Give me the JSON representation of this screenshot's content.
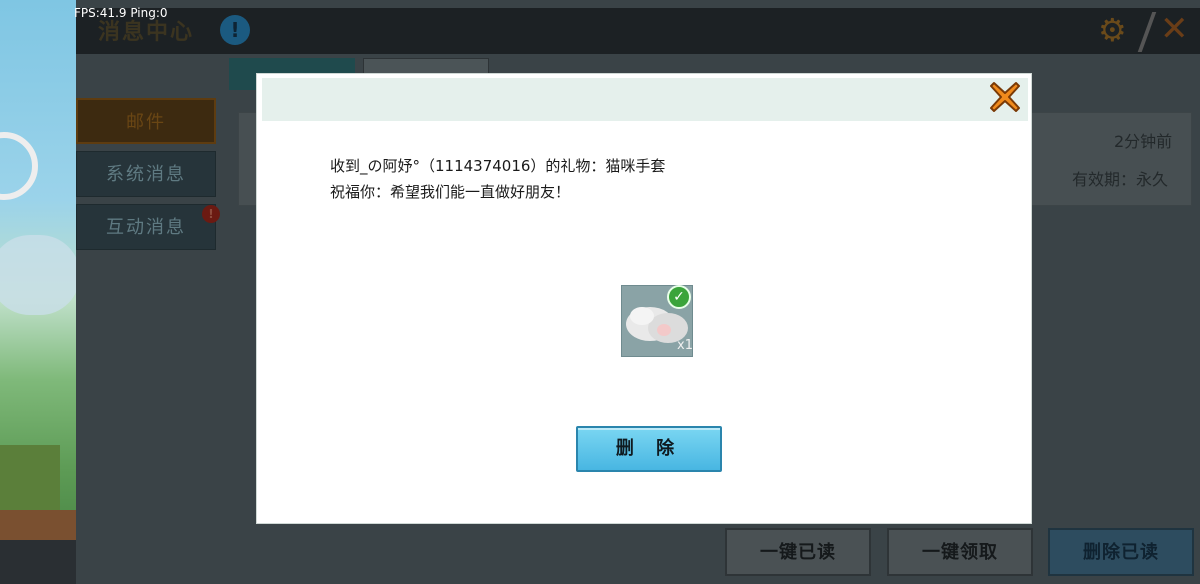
{
  "overlay": {
    "fps_ping": "FPS:41.9  Ping:0"
  },
  "header": {
    "title": "消息中心",
    "info_icon": "info-icon",
    "settings_icon": "gear-icon",
    "close_icon": "close-icon"
  },
  "sidebar": {
    "items": [
      {
        "label": "邮件",
        "active": true
      },
      {
        "label": "系统消息",
        "active": false
      },
      {
        "label": "互动消息",
        "active": false,
        "badge": "!"
      }
    ]
  },
  "mail_list": {
    "item": {
      "time": "2分钟前",
      "validity": "有效期：永久"
    }
  },
  "actions": {
    "read_all": "一键已读",
    "collect_all": "一键领取",
    "delete_read": "删除已读"
  },
  "modal": {
    "message_line1": "收到_の阿妤°（1114374016）的礼物：猫咪手套",
    "message_line2": "祝福你：希望我们能一直做好朋友！",
    "attachment": {
      "name": "猫咪手套",
      "quantity": "x1",
      "claimed": true
    },
    "delete_label": "删 除",
    "colors": {
      "accent": "#48b6e2",
      "close": "#f08a1c",
      "check": "#3ba43b"
    }
  }
}
